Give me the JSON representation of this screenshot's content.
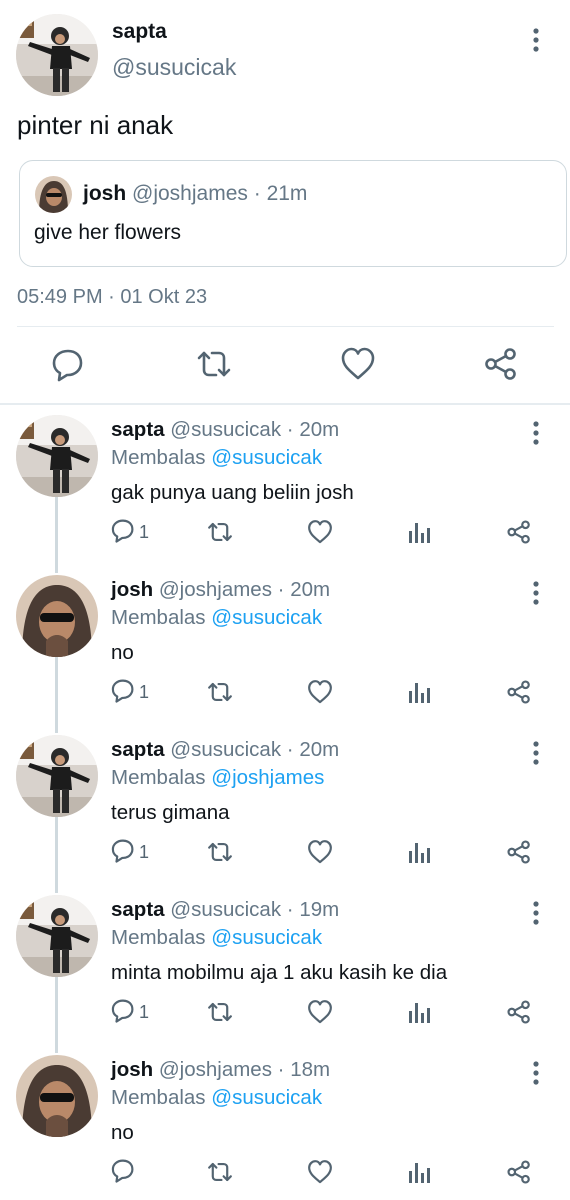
{
  "main_tweet": {
    "author_name": "sapta",
    "author_handle": "@susucicak",
    "text": "pinter ni anak",
    "quoted": {
      "author_name": "josh",
      "author_handle": "@joshjames",
      "separator": "·",
      "time": "21m",
      "text": "give her flowers"
    },
    "timestamp": "05:49 PM · 01 Okt 23",
    "actions": [
      "reply-icon",
      "retweet-icon",
      "like-icon",
      "share-icon"
    ]
  },
  "replies": [
    {
      "name": "sapta",
      "handle": "@susucicak",
      "separator": "·",
      "time": "20m",
      "replying_prefix": "Membalas",
      "replying_to": "@susucicak",
      "text": "gak punya uang beliin josh",
      "reply_count": "1",
      "avatar": "kid"
    },
    {
      "name": "josh",
      "handle": "@joshjames",
      "separator": "·",
      "time": "20m",
      "replying_prefix": "Membalas",
      "replying_to": "@susucicak",
      "text": "no",
      "reply_count": "1",
      "avatar": "hood"
    },
    {
      "name": "sapta",
      "handle": "@susucicak",
      "separator": "·",
      "time": "20m",
      "replying_prefix": "Membalas",
      "replying_to": "@joshjames",
      "text": "terus gimana",
      "reply_count": "1",
      "avatar": "kid"
    },
    {
      "name": "sapta",
      "handle": "@susucicak",
      "separator": "·",
      "time": "19m",
      "replying_prefix": "Membalas",
      "replying_to": "@susucicak",
      "text": "minta mobilmu aja 1 aku kasih ke dia",
      "reply_count": "1",
      "avatar": "kid"
    },
    {
      "name": "josh",
      "handle": "@joshjames",
      "separator": "·",
      "time": "18m",
      "replying_prefix": "Membalas",
      "replying_to": "@susucicak",
      "text": "no",
      "reply_count": "",
      "avatar": "hood"
    }
  ],
  "colors": {
    "link": "#1da1f2",
    "muted": "#657786",
    "icon": "#536471",
    "border": "#cfd9de"
  }
}
